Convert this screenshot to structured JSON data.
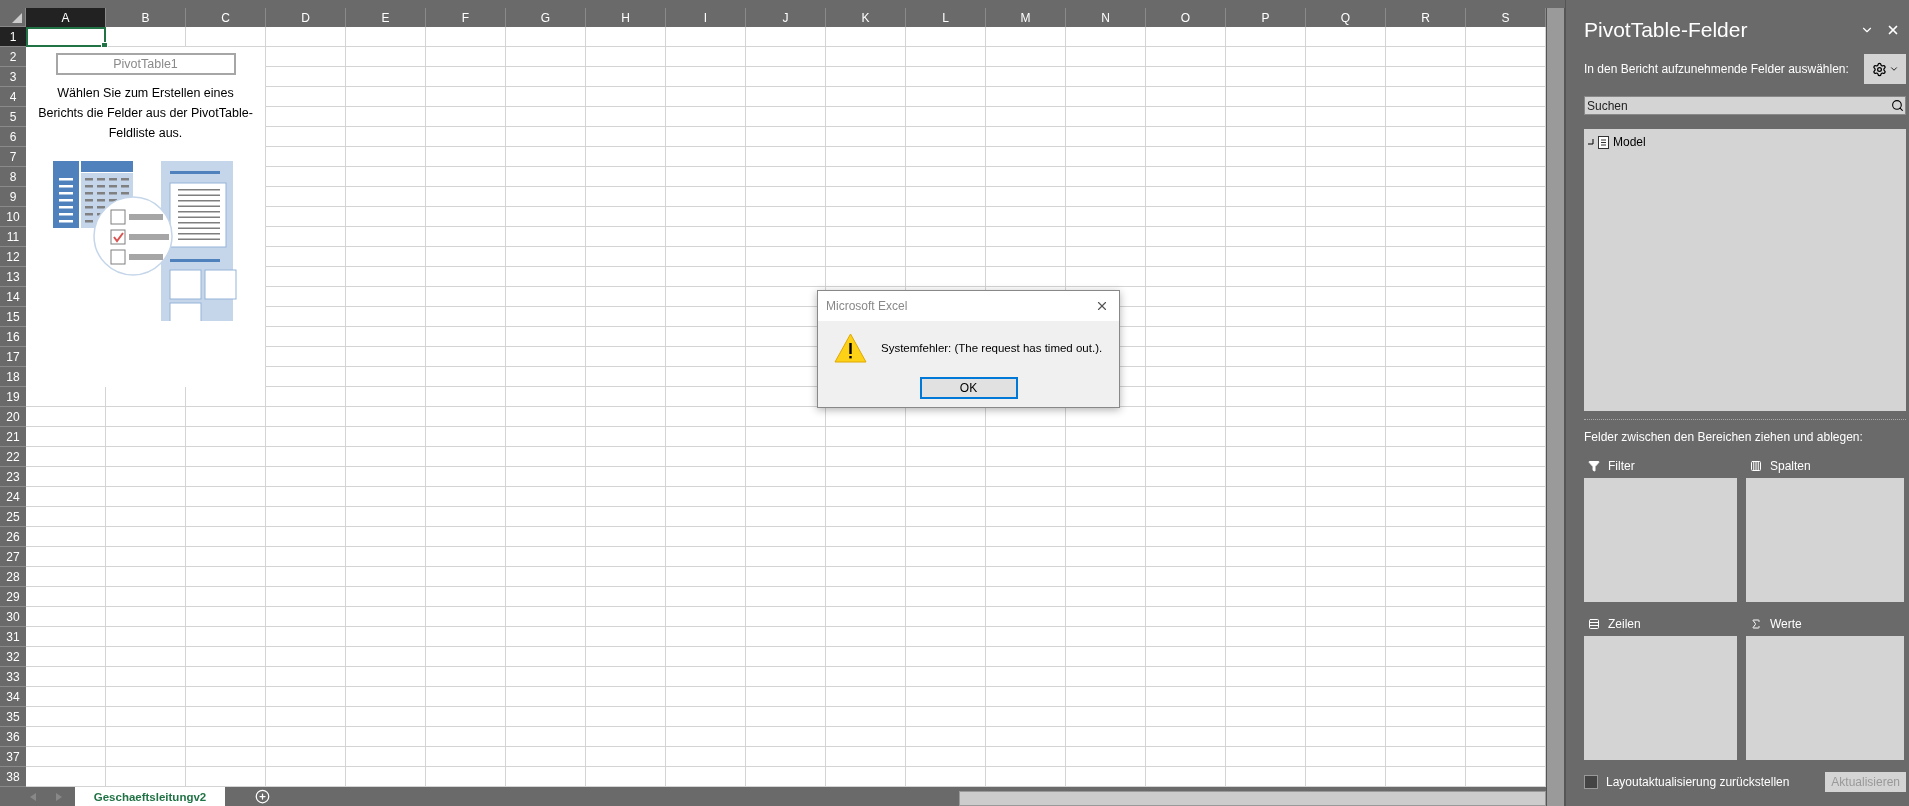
{
  "sheet": {
    "columns": [
      {
        "label": "A",
        "selected": true
      },
      {
        "label": "B",
        "selected": false
      },
      {
        "label": "C",
        "selected": false
      },
      {
        "label": "D",
        "selected": false
      },
      {
        "label": "E",
        "selected": false
      },
      {
        "label": "F",
        "selected": false
      },
      {
        "label": "G",
        "selected": false
      },
      {
        "label": "H",
        "selected": false
      },
      {
        "label": "I",
        "selected": false
      },
      {
        "label": "J",
        "selected": false
      },
      {
        "label": "K",
        "selected": false
      },
      {
        "label": "L",
        "selected": false
      },
      {
        "label": "M",
        "selected": false
      },
      {
        "label": "N",
        "selected": false
      },
      {
        "label": "O",
        "selected": false
      },
      {
        "label": "P",
        "selected": false
      },
      {
        "label": "Q",
        "selected": false
      },
      {
        "label": "R",
        "selected": false
      },
      {
        "label": "S",
        "selected": false
      }
    ],
    "rows": [
      {
        "label": "1",
        "selected": true
      },
      {
        "label": "2",
        "selected": false
      },
      {
        "label": "3",
        "selected": false
      },
      {
        "label": "4",
        "selected": false
      },
      {
        "label": "5",
        "selected": false
      },
      {
        "label": "6",
        "selected": false
      },
      {
        "label": "7",
        "selected": false
      },
      {
        "label": "8",
        "selected": false
      },
      {
        "label": "9",
        "selected": false
      },
      {
        "label": "10",
        "selected": false
      },
      {
        "label": "11",
        "selected": false
      },
      {
        "label": "12",
        "selected": false
      },
      {
        "label": "13",
        "selected": false
      },
      {
        "label": "14",
        "selected": false
      },
      {
        "label": "15",
        "selected": false
      },
      {
        "label": "16",
        "selected": false
      },
      {
        "label": "17",
        "selected": false
      },
      {
        "label": "18",
        "selected": false
      },
      {
        "label": "19",
        "selected": false
      },
      {
        "label": "20",
        "selected": false
      },
      {
        "label": "21",
        "selected": false
      },
      {
        "label": "22",
        "selected": false
      },
      {
        "label": "23",
        "selected": false
      },
      {
        "label": "24",
        "selected": false
      },
      {
        "label": "25",
        "selected": false
      },
      {
        "label": "26",
        "selected": false
      },
      {
        "label": "27",
        "selected": false
      },
      {
        "label": "28",
        "selected": false
      },
      {
        "label": "29",
        "selected": false
      },
      {
        "label": "30",
        "selected": false
      },
      {
        "label": "31",
        "selected": false
      },
      {
        "label": "32",
        "selected": false
      },
      {
        "label": "33",
        "selected": false
      },
      {
        "label": "34",
        "selected": false
      },
      {
        "label": "35",
        "selected": false
      },
      {
        "label": "36",
        "selected": false
      },
      {
        "label": "37",
        "selected": false
      },
      {
        "label": "38",
        "selected": false
      }
    ]
  },
  "pivot_placeholder": {
    "name": "PivotTable1",
    "instructions": "Wählen Sie zum Erstellen eines Berichts die Felder aus der PivotTable-Feldliste aus."
  },
  "sheet_tabs": [
    {
      "label": "Geschaeftsleitungv2",
      "selected": true
    }
  ],
  "dialog": {
    "title": "Microsoft Excel",
    "message": "Systemfehler:  (The request has timed out.).",
    "button": "OK"
  },
  "field_pane": {
    "title": "PivotTable-Felder",
    "subtitle": "In den Bericht aufzunehmende Felder auswählen:",
    "search": {
      "placeholder": "Suchen"
    },
    "fields": [
      {
        "label": "Model"
      }
    ],
    "areas_heading": "Felder zwischen den Bereichen ziehen und ablegen:",
    "areas": [
      {
        "kind": "filter",
        "label": "Filter"
      },
      {
        "kind": "columns",
        "label": "Spalten"
      },
      {
        "kind": "rows",
        "label": "Zeilen"
      },
      {
        "kind": "values",
        "label": "Werte"
      }
    ],
    "defer_update": {
      "label": "Layoutaktualisierung zurückstellen",
      "checked": false
    },
    "update_button": {
      "label": "Aktualisieren",
      "disabled": true
    }
  }
}
